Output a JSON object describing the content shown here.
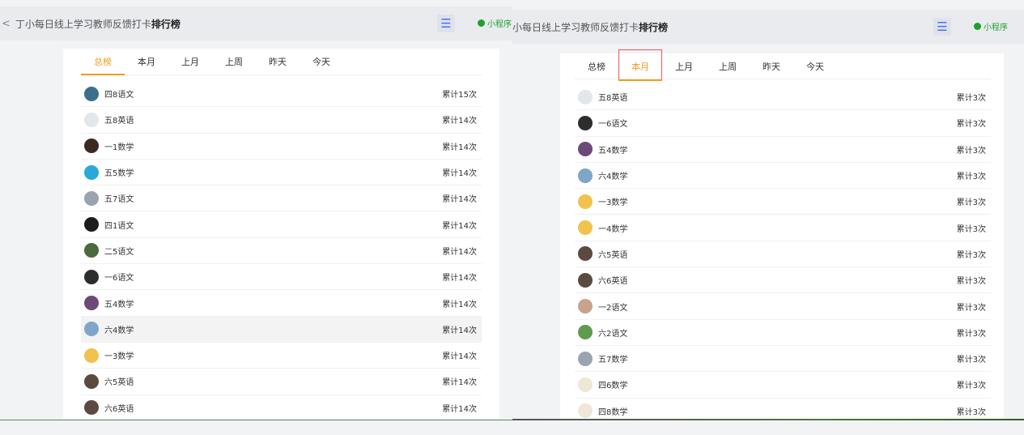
{
  "left": {
    "title_back": "<",
    "title_main": "丁小每日线上学习教师反馈打卡",
    "title_bold": "排行榜",
    "mini_label": "小程序",
    "tabs": [
      "总榜",
      "本月",
      "上月",
      "上周",
      "昨天",
      "今天"
    ],
    "active_tab": 0,
    "rows": [
      {
        "name": "四8语文",
        "count": "累计15次",
        "color": "#3d6f8d"
      },
      {
        "name": "五8英语",
        "count": "累计14次",
        "color": "#e3e6ea"
      },
      {
        "name": "一1数学",
        "count": "累计14次",
        "color": "#3a2a22"
      },
      {
        "name": "五5数学",
        "count": "累计14次",
        "color": "#2aa8d8"
      },
      {
        "name": "五7语文",
        "count": "累计14次",
        "color": "#9aa4b1"
      },
      {
        "name": "四1语文",
        "count": "累计14次",
        "color": "#1d1d1d"
      },
      {
        "name": "二5语文",
        "count": "累计14次",
        "color": "#4b6a3d"
      },
      {
        "name": "一6语文",
        "count": "累计14次",
        "color": "#2d2d2d"
      },
      {
        "name": "五4数学",
        "count": "累计14次",
        "color": "#6b4a7a"
      },
      {
        "name": "六4数学",
        "count": "累计14次",
        "color": "#7fa6c9",
        "highlight": true
      },
      {
        "name": "一3数学",
        "count": "累计14次",
        "color": "#f2c24f"
      },
      {
        "name": "六5英语",
        "count": "累计14次",
        "color": "#5b4a3f"
      },
      {
        "name": "六6英语",
        "count": "累计14次",
        "color": "#5b4a3f"
      }
    ]
  },
  "right": {
    "title_main": "小每日线上学习教师反馈打卡",
    "title_bold": "排行榜",
    "mini_label": "小程序",
    "tabs": [
      "总榜",
      "本月",
      "上月",
      "上周",
      "昨天",
      "今天"
    ],
    "active_tab": 1,
    "rows": [
      {
        "name": "五8英语",
        "count": "累计3次",
        "color": "#e3e6ea"
      },
      {
        "name": "一6语文",
        "count": "累计3次",
        "color": "#2d2d2d"
      },
      {
        "name": "五4数学",
        "count": "累计3次",
        "color": "#6b4a7a"
      },
      {
        "name": "六4数学",
        "count": "累计3次",
        "color": "#7fa6c9"
      },
      {
        "name": "一3数学",
        "count": "累计3次",
        "color": "#f2c24f"
      },
      {
        "name": "一4数学",
        "count": "累计3次",
        "color": "#f2c24f"
      },
      {
        "name": "六5英语",
        "count": "累计3次",
        "color": "#5b4a3f"
      },
      {
        "name": "六6英语",
        "count": "累计3次",
        "color": "#5b4a3f"
      },
      {
        "name": "一2语文",
        "count": "累计3次",
        "color": "#c8a38a"
      },
      {
        "name": "六2语文",
        "count": "累计3次",
        "color": "#5f9b4f"
      },
      {
        "name": "五7数学",
        "count": "累计3次",
        "color": "#9aa4b1"
      },
      {
        "name": "四6数学",
        "count": "累计3次",
        "color": "#f0e6d6"
      },
      {
        "name": "四8数学",
        "count": "累计3次",
        "color": "#f0e6d6"
      }
    ]
  }
}
